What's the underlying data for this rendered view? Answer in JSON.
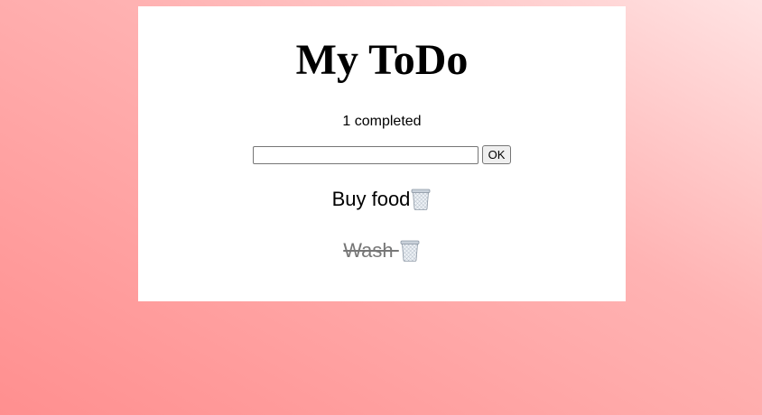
{
  "app": {
    "title": "My ToDo",
    "completed_text": "1 completed"
  },
  "add_form": {
    "input_value": "",
    "input_placeholder": "",
    "ok_label": "OK"
  },
  "todos": [
    {
      "label": "Buy food",
      "completed": false,
      "delete_icon": "trash-icon"
    },
    {
      "label": "Wash ",
      "completed": true,
      "delete_icon": "trash-icon"
    }
  ],
  "colors": {
    "background_gradient_start": "#ffe3e3",
    "background_gradient_end": "#ff8f8f",
    "card": "#ffffff",
    "completed_text": "#777777"
  }
}
